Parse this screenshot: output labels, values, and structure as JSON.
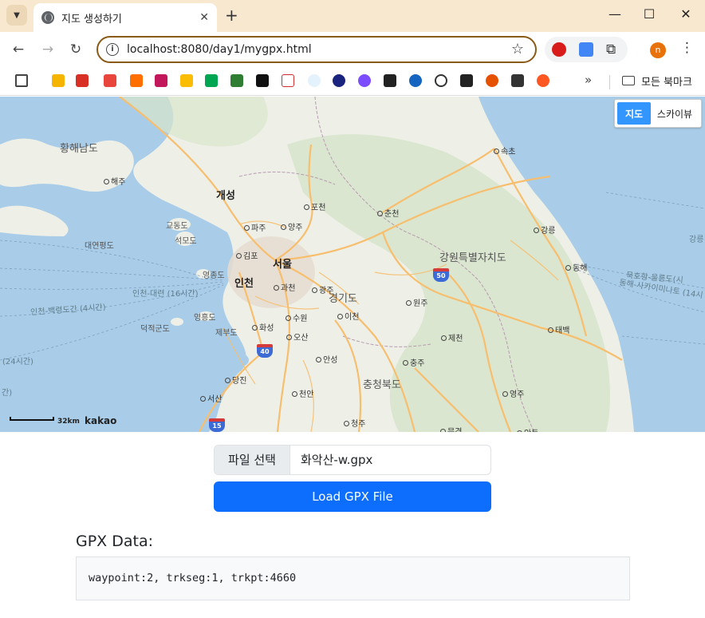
{
  "browser": {
    "tab_title": "지도 생성하기",
    "tab_close": "✕",
    "new_tab": "+",
    "url": "localhost:8080/day1/mygpx.html",
    "profile_initial": "n",
    "window_controls": {
      "minimize": "—",
      "maximize": "☐",
      "close": "✕"
    },
    "bookmarks_more": "»",
    "bookmarks_folder_label": "모든 북마크"
  },
  "map": {
    "type_control": {
      "active": "지도",
      "other": "스카이뷰"
    },
    "labels": {
      "hwanghae": "황해남도",
      "haeju": "해주",
      "gaeseong": "개성",
      "gyodongdo": "교동도",
      "seokmodo": "석모도",
      "daeyeonpyeongdo": "대연평도",
      "paju": "파주",
      "pocheon": "포천",
      "chuncheon": "춘천",
      "sokcho": "속초",
      "gangneung": "강릉",
      "donghae": "동해",
      "gangwon": "강원특별자치도",
      "yangju": "양주",
      "gimpo": "김포",
      "seoul": "서울",
      "yeongjongdo": "영종도",
      "incheon": "인천",
      "gwacheon": "과천",
      "gwangju": "광주",
      "gyeonggi": "경기도",
      "wonju": "원주",
      "route_incheon_daeyeon": "인천-대련 (16시간)",
      "route_incheon_baengnyeong": "인천-백령도간 (4시간)",
      "deokjeokdo": "덕적군도",
      "yeongheungdo": "영흥도",
      "jebudo": "제부도",
      "hwaseong": "화성",
      "suwon": "수원",
      "icheon": "이천",
      "osan": "오산",
      "jecheon": "제천",
      "taebaek": "태백",
      "route_24": "(24시간)",
      "route_edge": "간)",
      "anseong": "안성",
      "chungju": "충주",
      "dangjin": "당진",
      "chungbuk": "충청북도",
      "seosan": "서산",
      "cheonan": "천안",
      "yeongju": "영주",
      "cheongju": "청주",
      "mungyeong": "문경",
      "andong": "안동",
      "mukho_ulleung": "묵호항-울릉도(시",
      "donghae_sakhalin": "동해-사카이미나토 (14시",
      "east_edge": "강릉"
    },
    "shields": {
      "r50": "50",
      "r40": "40",
      "r15": "15"
    },
    "scale_label": "32km",
    "attribution": "kakao",
    "colors": {
      "sea": "#a9cde8",
      "land": "#eef0e8",
      "forest": "#cfe0c3",
      "road": "#f7be6e",
      "urban": "#e6dcd0"
    }
  },
  "form": {
    "file_button": "파일 선택",
    "file_name": "화악산-w.gpx",
    "load_button": "Load GPX File"
  },
  "gpx": {
    "heading": "GPX Data:",
    "summary": "waypoint:2, trkseg:1, trkpt:4660"
  },
  "colors": {
    "primary": "#0d6efd",
    "chrome": "#f8e8cf",
    "omnibox_border": "#8a5a16"
  }
}
